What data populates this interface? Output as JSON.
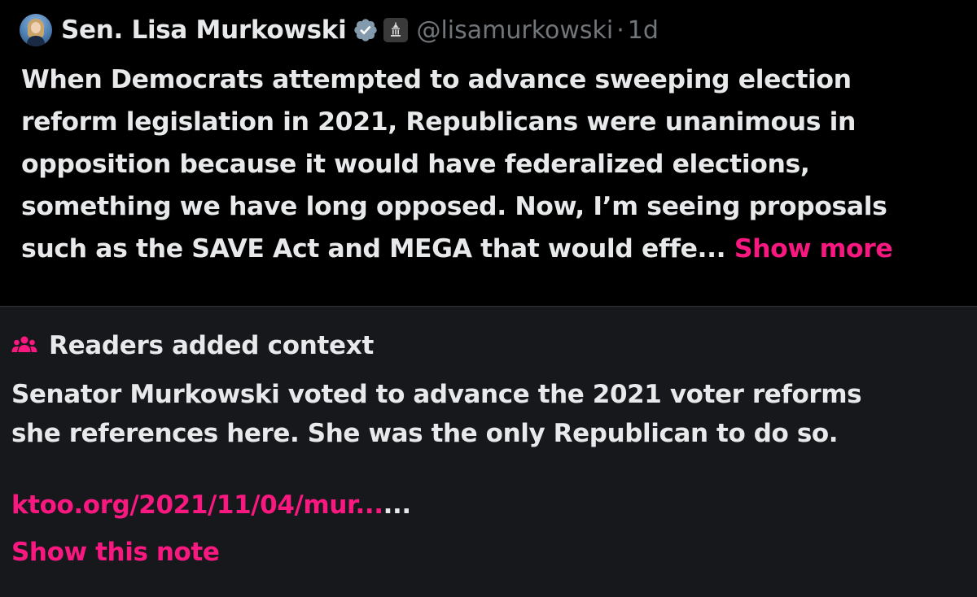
{
  "tweet": {
    "display_name": "Sen. Lisa Murkowski",
    "handle": "@lisamurkowski",
    "separator": "·",
    "time": "1d",
    "text": "When Democrats attempted to advance sweeping election\nreform legislation in 2021, Republicans were unanimous in\nopposition because it would have federalized elections,\nsomething we have long opposed. Now, I’m seeing proposals\nsuch as the SAVE Act and MEGA that would effe... ",
    "show_more": "Show more",
    "icons": {
      "avatar": "profile-photo",
      "verified": "verified-badge-icon",
      "government": "government-building-icon"
    }
  },
  "note": {
    "title": "Readers added context",
    "icon": "people-icon",
    "text": "Senator Murkowski voted to advance the 2021 voter reforms\nshe references here. She was the only Republican to do so.",
    "link_text": "ktoo.org/2021/11/04/mur...",
    "link_suffix": "...",
    "show_note": "Show this note"
  },
  "colors": {
    "accent": "#f91880",
    "tweet_background": "#000000",
    "note_background": "#16181c",
    "primary_text": "#e7e9ea",
    "secondary_text": "#71767b",
    "verified_badge": "#829aab"
  }
}
